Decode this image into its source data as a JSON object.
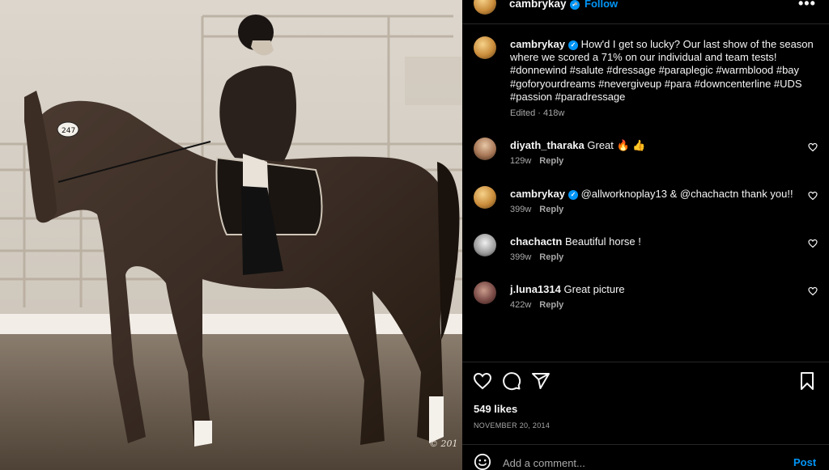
{
  "post": {
    "author": "cambrykay",
    "follow_label": "Follow",
    "dot": "•",
    "more_label": "•••",
    "photo_watermark": "© 201"
  },
  "caption": {
    "username": "cambrykay",
    "text": "How'd I get so lucky? Our last show of the season where we scored a 71% on our individual and team tests! #donnewind #salute #dressage #paraplegic #warmblood #bay #goforyourdreams #nevergiveup #para #downcenterline #UDS #passion #paradressage",
    "meta": "Edited · 418w"
  },
  "comments": [
    {
      "username": "diyath_tharaka",
      "text": "Great 🔥 👍",
      "age": "129w",
      "reply_label": "Reply",
      "verified": false
    },
    {
      "username": "cambrykay",
      "text": "@allworknoplay13 & @chachactn thank you!!",
      "age": "399w",
      "reply_label": "Reply",
      "verified": true
    },
    {
      "username": "chachactn",
      "text": "Beautiful horse !",
      "age": "399w",
      "reply_label": "Reply",
      "verified": false
    },
    {
      "username": "j.luna1314",
      "text": "Great picture",
      "age": "422w",
      "reply_label": "Reply",
      "verified": false
    }
  ],
  "engagement": {
    "likes": "549 likes",
    "date": "NOVEMBER 20, 2014"
  },
  "composer": {
    "placeholder": "Add a comment...",
    "post_label": "Post"
  },
  "colors": {
    "accent": "#0095f6",
    "background": "#000000",
    "secondary_text": "#a8a8a8",
    "divider": "#262626"
  },
  "icons": {
    "like": "heart-icon",
    "comment": "comment-icon",
    "share": "share-icon",
    "save": "bookmark-icon",
    "emoji": "emoji-icon",
    "more": "more-options-icon",
    "verified": "verified-badge-icon",
    "comment_like": "small-heart-icon"
  }
}
